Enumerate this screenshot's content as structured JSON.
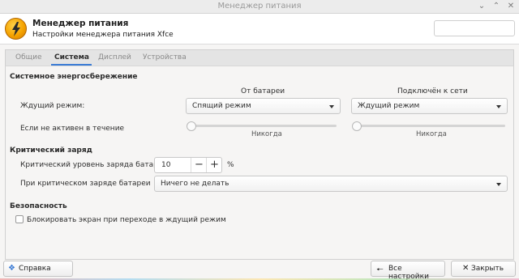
{
  "window": {
    "title": "Менеджер питания",
    "controls": [
      "minimize-icon",
      "maximize-icon",
      "close-icon"
    ]
  },
  "header": {
    "app_name": "Менеджер питания",
    "subtitle": "Настройки менеджера питания Xfce",
    "search_placeholder": ""
  },
  "tabs": [
    {
      "label": "Общие",
      "active": false
    },
    {
      "label": "Система",
      "active": true
    },
    {
      "label": "Дисплей",
      "active": false
    },
    {
      "label": "Устройства",
      "active": false
    }
  ],
  "system": {
    "section_title": "Системное энергосбережение",
    "col_battery": "От батареи",
    "col_ac": "Подключён к сети",
    "sleep_label": "Ждущий режим:",
    "sleep_battery_value": "Спящий режим",
    "sleep_ac_value": "Ждущий режим",
    "inactive_label": "Если не активен в течение",
    "inactive_battery_text": "Никогда",
    "inactive_ac_text": "Никогда",
    "inactive_battery_level": 0,
    "inactive_ac_level": 0
  },
  "critical": {
    "section_title": "Критический заряд",
    "level_label": "Критический уровень заряда батареи:",
    "level_value": "10",
    "level_unit": "%",
    "action_label": "При критическом заряде батареи",
    "action_value": "Ничего не делать"
  },
  "security": {
    "section_title": "Безопасность",
    "lock_label": "Блокировать экран при переходе в ждущий режим",
    "lock_checked": false
  },
  "footer": {
    "help_label": "Справка",
    "all_settings_label": "Все настройки",
    "close_label": "Закрыть"
  },
  "colors": {
    "accent": "#3a7bd5",
    "icon": "#f5a300"
  }
}
